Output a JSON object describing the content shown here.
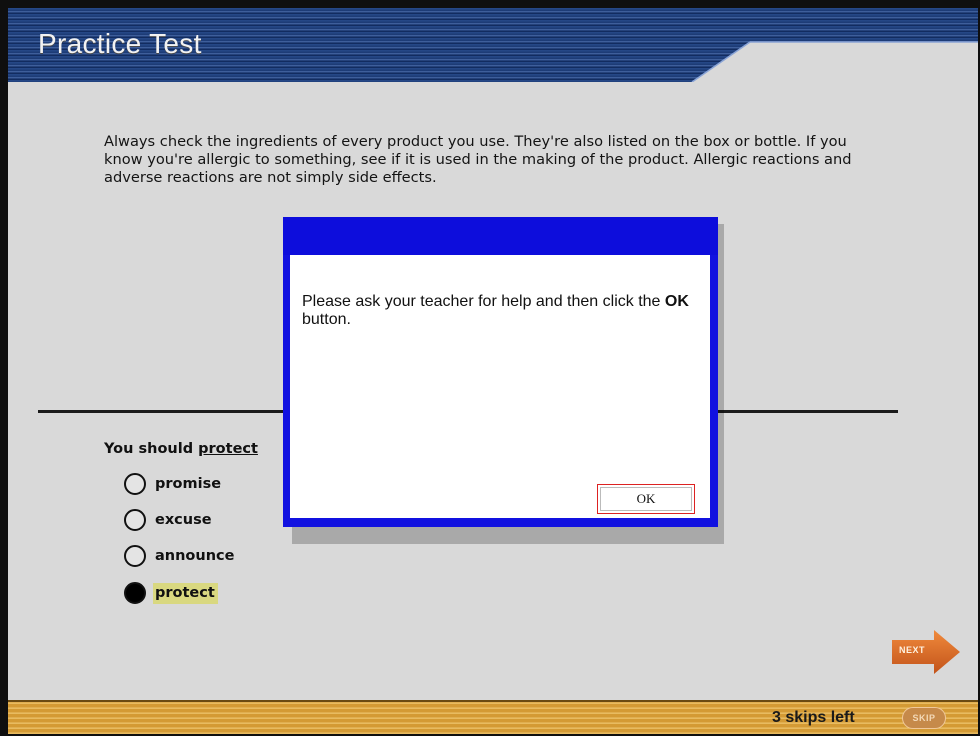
{
  "header": {
    "title": "Practice Test"
  },
  "passage": {
    "text": "Always check the ingredients of every product you use. They're also listed on the box or bottle. If you know you're allergic to something, see if it is used in the making of the product. Allergic reactions and adverse reactions are not simply side effects."
  },
  "question": {
    "prefix": "You should ",
    "target": "protect"
  },
  "choices": [
    {
      "label": "promise",
      "selected": false
    },
    {
      "label": "excuse",
      "selected": false
    },
    {
      "label": "announce",
      "selected": false
    },
    {
      "label": "protect",
      "selected": true
    }
  ],
  "navigation": {
    "next_label": "NEXT",
    "skips_left": "3 skips left",
    "skip_label": "SKIP"
  },
  "dialog": {
    "message_before": "Please ask your teacher for help and then click the ",
    "message_bold": "OK",
    "message_after": " button.",
    "ok_label": "OK"
  },
  "colors": {
    "header_blue": "#1b3e7c",
    "dialog_blue": "#1111e0",
    "next_orange": "#d9651f",
    "footer_gold": "#d9a23a",
    "selected_highlight": "#d9d880"
  },
  "icons": {
    "next": "arrow-right-icon",
    "radio_empty": "radio-unselected-icon",
    "radio_filled": "radio-selected-icon"
  }
}
